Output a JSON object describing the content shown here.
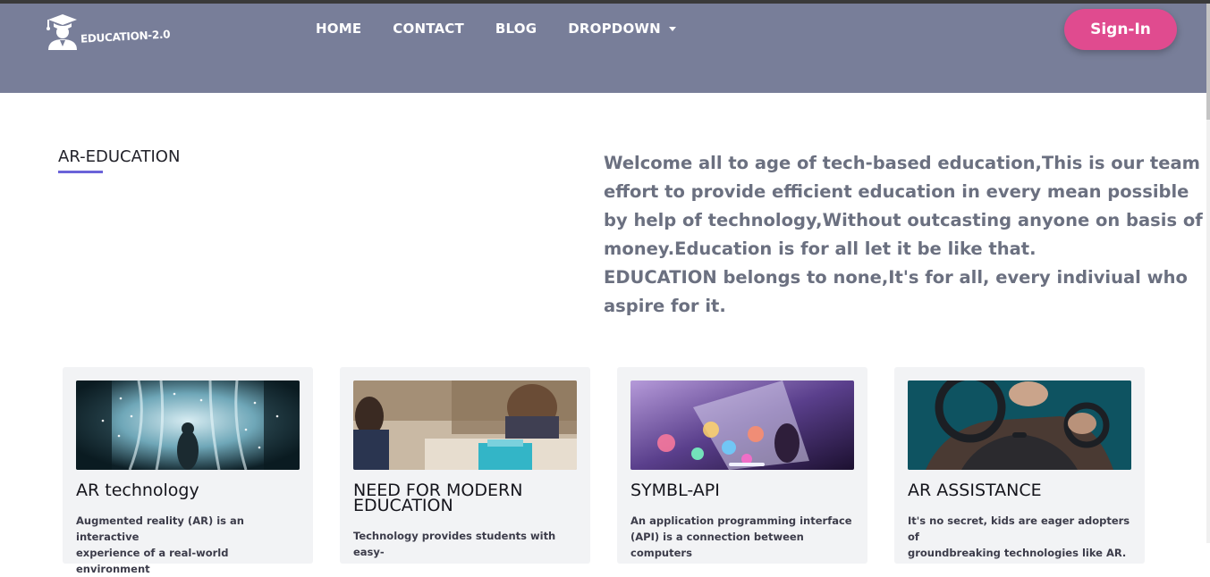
{
  "navbar": {
    "logo_text": "EDUCATION-2.0",
    "items": [
      {
        "label": "HOME"
      },
      {
        "label": "CONTACT"
      },
      {
        "label": "BLOG"
      },
      {
        "label": "DROPDOWN"
      }
    ],
    "signin_label": "Sign-In",
    "background_color": "#787e99",
    "signin_color": "#e04b8f"
  },
  "hero": {
    "section_title": "AR-EDUCATION",
    "accent_color": "#6b63d9",
    "intro_lines": [
      "Welcome all to age of tech-based education,This is our team",
      "effort to provide efficient education in every mean possible",
      "by help of technology,Without outcasting anyone on basis of",
      "money.Education is for all let it be like that.",
      "EDUCATION belongs to none,It's for all, every indiviual who",
      "aspire for it."
    ]
  },
  "cards": [
    {
      "title": "AR technology",
      "text_lines": [
        "Augmented reality (AR) is an interactive",
        "experience of a real-world environment"
      ],
      "image_icon": "ar-technology-image"
    },
    {
      "title_lines": [
        "NEED FOR MODERN",
        "EDUCATION"
      ],
      "text_lines": [
        "Technology provides students with easy-"
      ],
      "image_icon": "modern-education-image"
    },
    {
      "title": "SYMBL-API",
      "text_lines": [
        "An application programming interface",
        "(API) is a connection between computers"
      ],
      "image_icon": "symbl-api-image"
    },
    {
      "title": "AR ASSISTANCE",
      "text_lines": [
        "It's no secret, kids are eager adopters of",
        "groundbreaking technologies like AR."
      ],
      "image_icon": "ar-assistance-image"
    }
  ]
}
